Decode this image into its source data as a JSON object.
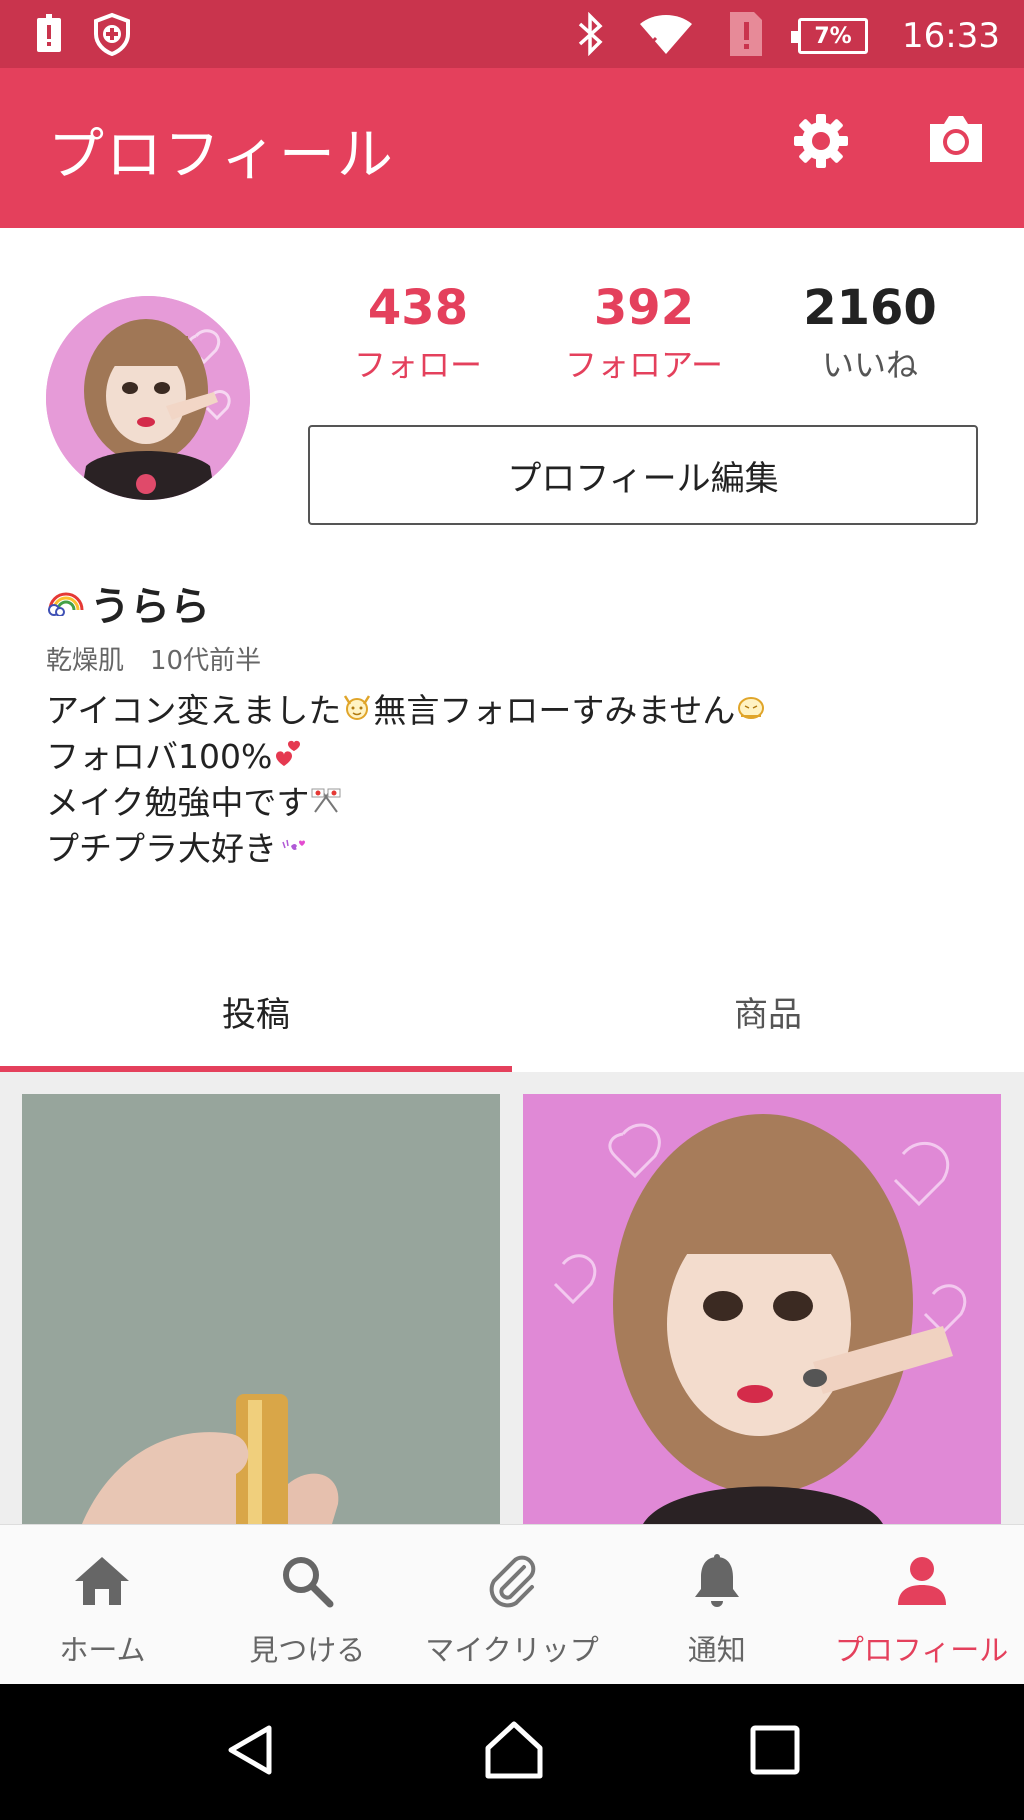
{
  "status_bar": {
    "battery": "7%",
    "time": "16:33"
  },
  "app_bar": {
    "title": "プロフィール"
  },
  "stats": [
    {
      "value": "438",
      "label": "フォロー",
      "color": "#e4405c"
    },
    {
      "value": "392",
      "label": "フォロアー",
      "color": "#e4405c"
    },
    {
      "value": "2160",
      "label": "いいね",
      "color": "#222222"
    }
  ],
  "edit_button": "プロフィール編集",
  "profile": {
    "name": "うらら",
    "meta": "乾燥肌　10代前半",
    "bio": [
      "アイコン変えました",
      "無言フォローすみません",
      "フォロバ100%",
      "メイク勉強中です",
      "プチプラ大好き"
    ]
  },
  "tabs": [
    {
      "label": "投稿",
      "active": true
    },
    {
      "label": "商品",
      "active": false
    }
  ],
  "bottom_nav": [
    {
      "label": "ホーム",
      "icon": "home-icon"
    },
    {
      "label": "見つける",
      "icon": "search-icon"
    },
    {
      "label": "マイクリップ",
      "icon": "paperclip-icon"
    },
    {
      "label": "通知",
      "icon": "bell-icon"
    },
    {
      "label": "プロフィール",
      "icon": "person-icon",
      "active": true
    }
  ],
  "colors": {
    "accent": "#e4405c",
    "status_bar": "#c9344d"
  }
}
